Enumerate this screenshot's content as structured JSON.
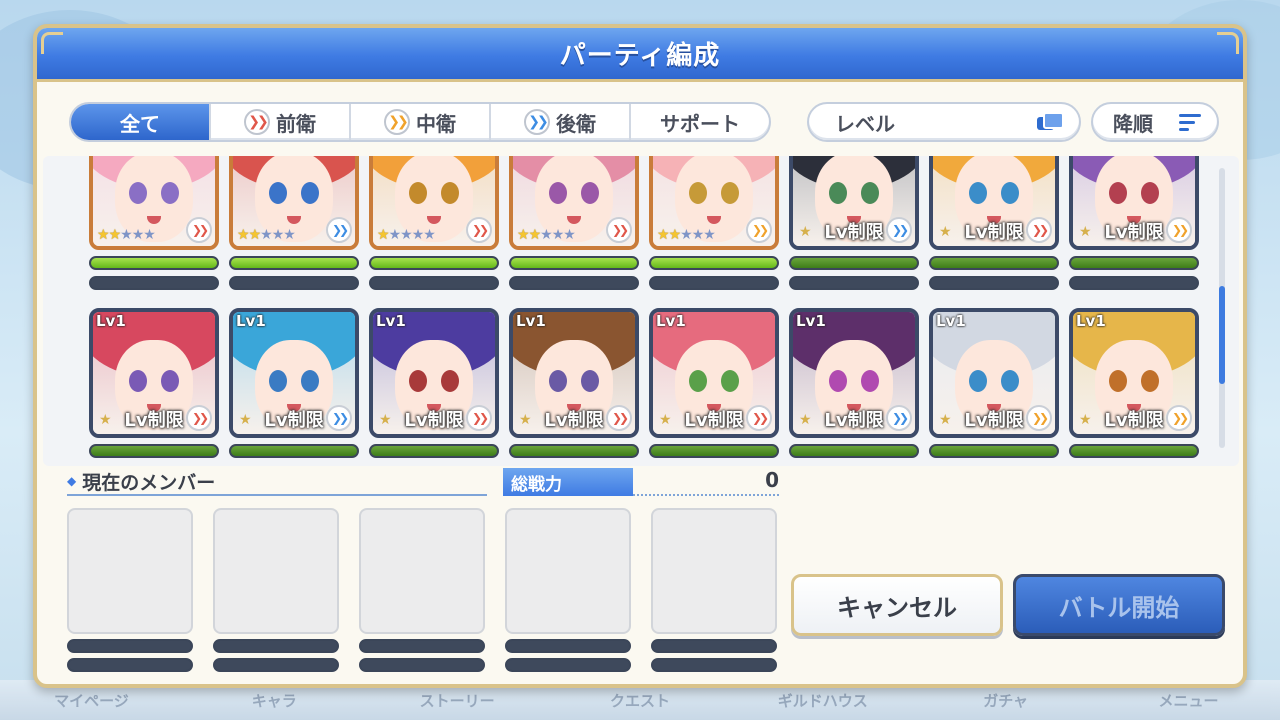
{
  "dialog": {
    "title": "パーティ編成"
  },
  "tabs": [
    {
      "label": "全て",
      "active": true,
      "icon": ""
    },
    {
      "label": "前衛",
      "active": false,
      "icon": "front-role-icon"
    },
    {
      "label": "中衛",
      "active": false,
      "icon": "mid-role-icon"
    },
    {
      "label": "後衛",
      "active": false,
      "icon": "back-role-icon"
    },
    {
      "label": "サポート",
      "active": false,
      "icon": ""
    }
  ],
  "sort": {
    "label": "レベル",
    "icon": "sort-select-icon"
  },
  "order": {
    "label": "降順",
    "icon": "sort-order-icon"
  },
  "roster": {
    "row1": [
      {
        "stars": 2,
        "role": "front",
        "locked": false,
        "hair": "#f5a9c0",
        "eyes": "#8a6fc5",
        "hp": "full"
      },
      {
        "stars": 2,
        "role": "back",
        "locked": false,
        "hair": "#d9544e",
        "eyes": "#3b74c9",
        "hp": "full"
      },
      {
        "stars": 1,
        "role": "front",
        "locked": false,
        "hair": "#f2a03a",
        "eyes": "#c38a2c",
        "hp": "full"
      },
      {
        "stars": 2,
        "role": "front",
        "locked": false,
        "hair": "#e48ea6",
        "eyes": "#9a58a8",
        "hp": "full"
      },
      {
        "stars": 2,
        "role": "mid",
        "locked": false,
        "hair": "#f6b2b6",
        "eyes": "#c69a38",
        "hp": "full"
      },
      {
        "stars": 1,
        "role": "back",
        "locked": true,
        "hair": "#2c2f3a",
        "eyes": "#4a8a58",
        "hp": "dark"
      },
      {
        "stars": 1,
        "role": "front",
        "locked": true,
        "hair": "#f1a93c",
        "eyes": "#3b8dc9",
        "hp": "dark"
      },
      {
        "stars": 1,
        "role": "mid",
        "locked": true,
        "hair": "#8a5bb5",
        "eyes": "#b34050",
        "hp": "dark"
      }
    ],
    "row2": [
      {
        "stars": 1,
        "role": "front",
        "hair": "#d7485f",
        "eyes": "#7a5ab5"
      },
      {
        "stars": 1,
        "role": "back",
        "hair": "#3aa6d9",
        "eyes": "#3a7bc3"
      },
      {
        "stars": 1,
        "role": "front",
        "hair": "#4d3ca0",
        "eyes": "#a83a3a"
      },
      {
        "stars": 1,
        "role": "front",
        "hair": "#8a5530",
        "eyes": "#6a5aa5"
      },
      {
        "stars": 1,
        "role": "front",
        "hair": "#e66b7e",
        "eyes": "#5aa04a"
      },
      {
        "stars": 1,
        "role": "back",
        "hair": "#5d2f6a",
        "eyes": "#b04ab0"
      },
      {
        "stars": 1,
        "role": "mid",
        "hair": "#d2d8e2",
        "eyes": "#3b8dc9"
      },
      {
        "stars": 1,
        "role": "mid",
        "hair": "#e6b64a",
        "eyes": "#c0702a"
      }
    ],
    "lv_badge": "Lv1",
    "lv_limit": "Lv制限"
  },
  "members": {
    "label": "現在のメンバー",
    "power_label": "総戦力",
    "power_value": "0",
    "slots": 5
  },
  "buttons": {
    "cancel": "キャンセル",
    "start": "バトル開始"
  },
  "bottom_nav": [
    "マイページ",
    "キャラ",
    "ストーリー",
    "クエスト",
    "ギルドハウス",
    "ガチャ",
    "メニュー"
  ]
}
